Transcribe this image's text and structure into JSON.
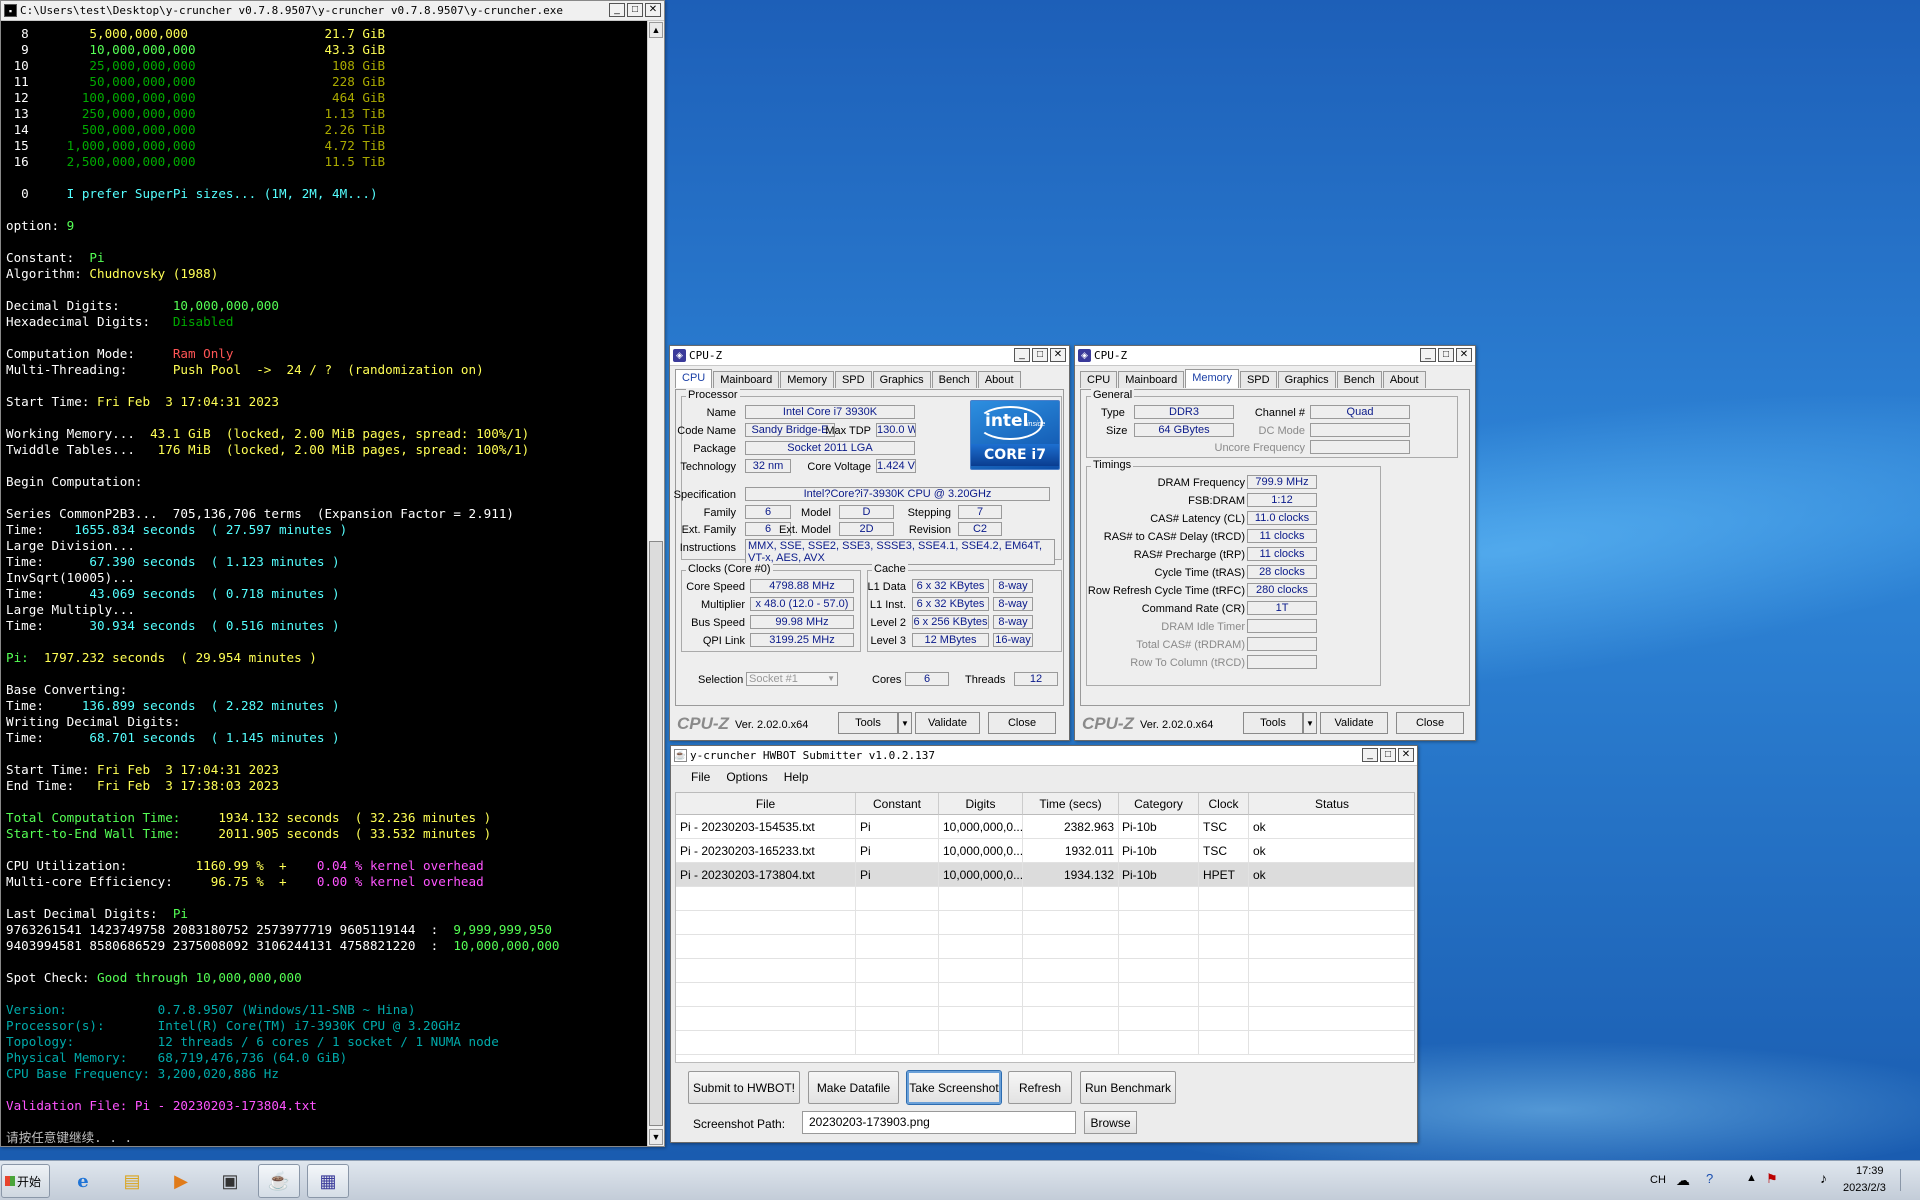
{
  "console": {
    "title": "C:\\Users\\test\\Desktop\\y-cruncher v0.7.8.9507\\y-cruncher v0.7.8.9507\\y-cruncher.exe",
    "lines": [
      [
        {
          "t": "  8        ",
          "c": "#ffffff"
        },
        {
          "t": "5,000,000,000",
          "c": "#ffff55"
        },
        {
          "t": "                  ",
          "c": "#ffffff"
        },
        {
          "t": "21.7 GiB",
          "c": "#ffff55"
        }
      ],
      [
        {
          "t": "  9        ",
          "c": "#ffffff"
        },
        {
          "t": "10,000,000,000",
          "c": "#55ff55"
        },
        {
          "t": "                 ",
          "c": "#ffffff"
        },
        {
          "t": "43.3 GiB",
          "c": "#ffff55"
        }
      ],
      [
        {
          "t": " 10        ",
          "c": "#ffffff"
        },
        {
          "t": "25,000,000,000",
          "c": "#00aa00"
        },
        {
          "t": "                  ",
          "c": "#ffffff"
        },
        {
          "t": "108 GiB",
          "c": "#aaaa00"
        }
      ],
      [
        {
          "t": " 11        ",
          "c": "#ffffff"
        },
        {
          "t": "50,000,000,000",
          "c": "#00aa00"
        },
        {
          "t": "                  ",
          "c": "#ffffff"
        },
        {
          "t": "228 GiB",
          "c": "#aaaa00"
        }
      ],
      [
        {
          "t": " 12       ",
          "c": "#ffffff"
        },
        {
          "t": "100,000,000,000",
          "c": "#00aa00"
        },
        {
          "t": "                  ",
          "c": "#ffffff"
        },
        {
          "t": "464 GiB",
          "c": "#aaaa00"
        }
      ],
      [
        {
          "t": " 13       ",
          "c": "#ffffff"
        },
        {
          "t": "250,000,000,000",
          "c": "#00aa00"
        },
        {
          "t": "                 ",
          "c": "#ffffff"
        },
        {
          "t": "1.13 TiB",
          "c": "#aaaa00"
        }
      ],
      [
        {
          "t": " 14       ",
          "c": "#ffffff"
        },
        {
          "t": "500,000,000,000",
          "c": "#00aa00"
        },
        {
          "t": "                 ",
          "c": "#ffffff"
        },
        {
          "t": "2.26 TiB",
          "c": "#aaaa00"
        }
      ],
      [
        {
          "t": " 15     ",
          "c": "#ffffff"
        },
        {
          "t": "1,000,000,000,000",
          "c": "#00aa00"
        },
        {
          "t": "                 ",
          "c": "#ffffff"
        },
        {
          "t": "4.72 TiB",
          "c": "#aaaa00"
        }
      ],
      [
        {
          "t": " 16     ",
          "c": "#ffffff"
        },
        {
          "t": "2,500,000,000,000",
          "c": "#00aa00"
        },
        {
          "t": "                 ",
          "c": "#ffffff"
        },
        {
          "t": "11.5 TiB",
          "c": "#aaaa00"
        }
      ],
      [],
      [
        {
          "t": "  0     ",
          "c": "#ffffff"
        },
        {
          "t": "I prefer SuperPi sizes... (1M, 2M, 4M...)",
          "c": "#55ffff"
        }
      ],
      [],
      [
        {
          "t": "option: ",
          "c": "#ffffff"
        },
        {
          "t": "9",
          "c": "#55ff55"
        }
      ],
      [],
      [
        {
          "t": "Constant:  ",
          "c": "#ffffff"
        },
        {
          "t": "Pi",
          "c": "#55ff55"
        }
      ],
      [
        {
          "t": "Algorithm: ",
          "c": "#ffffff"
        },
        {
          "t": "Chudnovsky (1988)",
          "c": "#ffff55"
        }
      ],
      [],
      [
        {
          "t": "Decimal Digits:       ",
          "c": "#ffffff"
        },
        {
          "t": "10,000,000,000",
          "c": "#55ff55"
        }
      ],
      [
        {
          "t": "Hexadecimal Digits:   ",
          "c": "#ffffff"
        },
        {
          "t": "Disabled",
          "c": "#00aa00"
        }
      ],
      [],
      [
        {
          "t": "Computation Mode:     ",
          "c": "#ffffff"
        },
        {
          "t": "Ram Only",
          "c": "#ff5555"
        }
      ],
      [
        {
          "t": "Multi-Threading:      ",
          "c": "#ffffff"
        },
        {
          "t": "Push Pool  ->  24 / ?  (randomization on)",
          "c": "#ffff55"
        }
      ],
      [],
      [
        {
          "t": "Start Time: ",
          "c": "#ffffff"
        },
        {
          "t": "Fri Feb  3 17:04:31 2023",
          "c": "#ffff55"
        }
      ],
      [],
      [
        {
          "t": "Working Memory...  ",
          "c": "#ffffff"
        },
        {
          "t": "43.1 GiB  (locked, 2.00 MiB pages, spread: 100%/1)",
          "c": "#ffff55"
        }
      ],
      [
        {
          "t": "Twiddle Tables...   ",
          "c": "#ffffff"
        },
        {
          "t": "176 MiB  (locked, 2.00 MiB pages, spread: 100%/1)",
          "c": "#ffff55"
        }
      ],
      [],
      [
        {
          "t": "Begin Computation:",
          "c": "#ffffff"
        }
      ],
      [],
      [
        {
          "t": "Series CommonP2B3...  705,136,706 terms  (Expansion Factor = 2.911)",
          "c": "#ffffff"
        }
      ],
      [
        {
          "t": "Time:    ",
          "c": "#ffffff"
        },
        {
          "t": "1655.834 seconds  ( 27.597 minutes )",
          "c": "#55ffff"
        }
      ],
      [
        {
          "t": "Large Division...",
          "c": "#ffffff"
        }
      ],
      [
        {
          "t": "Time:    ",
          "c": "#ffffff"
        },
        {
          "t": "  67.390 seconds  ( 1.123 minutes )",
          "c": "#55ffff"
        }
      ],
      [
        {
          "t": "InvSqrt(10005)...",
          "c": "#ffffff"
        }
      ],
      [
        {
          "t": "Time:    ",
          "c": "#ffffff"
        },
        {
          "t": "  43.069 seconds  ( 0.718 minutes )",
          "c": "#55ffff"
        }
      ],
      [
        {
          "t": "Large Multiply...",
          "c": "#ffffff"
        }
      ],
      [
        {
          "t": "Time:    ",
          "c": "#ffffff"
        },
        {
          "t": "  30.934 seconds  ( 0.516 minutes )",
          "c": "#55ffff"
        }
      ],
      [],
      [
        {
          "t": "Pi:  ",
          "c": "#55ff55"
        },
        {
          "t": "1797.232 seconds  ( 29.954 minutes )",
          "c": "#ffff55"
        }
      ],
      [],
      [
        {
          "t": "Base Converting:",
          "c": "#ffffff"
        }
      ],
      [
        {
          "t": "Time:    ",
          "c": "#ffffff"
        },
        {
          "t": " 136.899 seconds  ( 2.282 minutes )",
          "c": "#55ffff"
        }
      ],
      [
        {
          "t": "Writing Decimal Digits:",
          "c": "#ffffff"
        }
      ],
      [
        {
          "t": "Time:    ",
          "c": "#ffffff"
        },
        {
          "t": "  68.701 seconds  ( 1.145 minutes )",
          "c": "#55ffff"
        }
      ],
      [],
      [
        {
          "t": "Start Time: ",
          "c": "#ffffff"
        },
        {
          "t": "Fri Feb  3 17:04:31 2023",
          "c": "#ffff55"
        }
      ],
      [
        {
          "t": "End Time:   ",
          "c": "#ffffff"
        },
        {
          "t": "Fri Feb  3 17:38:03 2023",
          "c": "#ffff55"
        }
      ],
      [],
      [
        {
          "t": "Total Computation Time:     ",
          "c": "#55ff55"
        },
        {
          "t": "1934.132 seconds  ( 32.236 minutes )",
          "c": "#ffff55"
        }
      ],
      [
        {
          "t": "Start-to-End Wall Time:     ",
          "c": "#55ff55"
        },
        {
          "t": "2011.905 seconds  ( 33.532 minutes )",
          "c": "#ffff55"
        }
      ],
      [],
      [
        {
          "t": "CPU Utilization:         ",
          "c": "#ffffff"
        },
        {
          "t": "1160.99 %  +    ",
          "c": "#ffff55"
        },
        {
          "t": "0.04 % kernel overhead",
          "c": "#ff55ff"
        }
      ],
      [
        {
          "t": "Multi-core Efficiency:     ",
          "c": "#ffffff"
        },
        {
          "t": "96.75 %  +    ",
          "c": "#ffff55"
        },
        {
          "t": "0.00 % kernel overhead",
          "c": "#ff55ff"
        }
      ],
      [],
      [
        {
          "t": "Last Decimal Digits:  ",
          "c": "#ffffff"
        },
        {
          "t": "Pi",
          "c": "#55ff55"
        }
      ],
      [
        {
          "t": "9763261541 1423749758 2083180752 2573977719 9605119144  :  ",
          "c": "#ffffff"
        },
        {
          "t": "9,999,999,950",
          "c": "#55ff55"
        }
      ],
      [
        {
          "t": "9403994581 8580686529 2375008092 3106244131 4758821220  :  ",
          "c": "#ffffff"
        },
        {
          "t": "10,000,000,000",
          "c": "#55ff55"
        }
      ],
      [],
      [
        {
          "t": "Spot Check: ",
          "c": "#ffffff"
        },
        {
          "t": "Good through 10,000,000,000",
          "c": "#55ff55"
        }
      ],
      [],
      [
        {
          "t": "Version:            ",
          "c": "#00aaaa"
        },
        {
          "t": "0.7.8.9507 (Windows/11-SNB ~ Hina)",
          "c": "#00aaaa"
        }
      ],
      [
        {
          "t": "Processor(s):       ",
          "c": "#00aaaa"
        },
        {
          "t": "Intel(R) Core(TM) i7-3930K CPU @ 3.20GHz",
          "c": "#00aaaa"
        }
      ],
      [
        {
          "t": "Topology:           ",
          "c": "#00aaaa"
        },
        {
          "t": "12 threads / 6 cores / 1 socket / 1 NUMA node",
          "c": "#00aaaa"
        }
      ],
      [
        {
          "t": "Physical Memory:    ",
          "c": "#00aaaa"
        },
        {
          "t": "68,719,476,736 (64.0 GiB)",
          "c": "#00aaaa"
        }
      ],
      [
        {
          "t": "CPU Base Frequency: ",
          "c": "#00aaaa"
        },
        {
          "t": "3,200,020,886 Hz",
          "c": "#00aaaa"
        }
      ],
      [],
      [
        {
          "t": "Validation File: ",
          "c": "#ff55ff"
        },
        {
          "t": "Pi - 20230203-173804.txt",
          "c": "#ff55ff"
        }
      ],
      [],
      [
        {
          "t": "请按任意键继续. . .",
          "c": "#c0c0c0"
        }
      ]
    ]
  },
  "cpuz1": {
    "title": "CPU-Z",
    "tabs": [
      "CPU",
      "Mainboard",
      "Memory",
      "SPD",
      "Graphics",
      "Bench",
      "About"
    ],
    "processor_label": "Processor",
    "name_label": "Name",
    "name": "Intel Core i7 3930K",
    "codename_label": "Code Name",
    "codename": "Sandy Bridge-E",
    "maxtdp_label": "Max TDP",
    "maxtdp": "130.0 W",
    "package_label": "Package",
    "package": "Socket 2011 LGA",
    "tech_label": "Technology",
    "tech": "32 nm",
    "cv_label": "Core Voltage",
    "cv": "1.424 V",
    "spec_label": "Specification",
    "spec": "Intel?Core?i7-3930K CPU @ 3.20GHz",
    "family_label": "Family",
    "family": "6",
    "model_label": "Model",
    "model": "D",
    "stepping_label": "Stepping",
    "stepping": "7",
    "extfam_label": "Ext. Family",
    "extfam": "6",
    "extmod_label": "Ext. Model",
    "extmod": "2D",
    "rev_label": "Revision",
    "rev": "C2",
    "instr_label": "Instructions",
    "instr": "MMX, SSE, SSE2, SSE3, SSSE3, SSE4.1, SSE4.2, EM64T, VT-x, AES, AVX",
    "clocks_label": "Clocks (Core #0)",
    "cs_label": "Core Speed",
    "cs": "4798.88 MHz",
    "mult_label": "Multiplier",
    "mult": "x 48.0 (12.0 - 57.0)",
    "bus_label": "Bus Speed",
    "bus": "99.98 MHz",
    "qpi_label": "QPI Link",
    "qpi": "3199.25 MHz",
    "cache_label": "Cache",
    "l1d_label": "L1 Data",
    "l1d": "6 x 32 KBytes",
    "l1d_w": "8-way",
    "l1i_label": "L1 Inst.",
    "l1i": "6 x 32 KBytes",
    "l1i_w": "8-way",
    "l2_label": "Level 2",
    "l2": "6 x 256 KBytes",
    "l2_w": "8-way",
    "l3_label": "Level 3",
    "l3": "12 MBytes",
    "l3_w": "16-way",
    "sel_label": "Selection",
    "sel": "Socket #1",
    "cores_label": "Cores",
    "cores": "6",
    "threads_label": "Threads",
    "threads": "12",
    "logo_text": "intel",
    "logo_inside": "inside",
    "logo_core": "CORE i7",
    "brand": "CPU-Z",
    "version": "Ver. 2.02.0.x64",
    "tools": "Tools",
    "validate": "Validate",
    "close": "Close"
  },
  "cpuz2": {
    "title": "CPU-Z",
    "tabs": [
      "CPU",
      "Mainboard",
      "Memory",
      "SPD",
      "Graphics",
      "Bench",
      "About"
    ],
    "general_label": "General",
    "type_label": "Type",
    "type": "DDR3",
    "channel_label": "Channel #",
    "channel": "Quad",
    "size_label": "Size",
    "size": "64 GBytes",
    "dcmode_label": "DC Mode",
    "uncore_label": "Uncore Frequency",
    "timings_label": "Timings",
    "dram_label": "DRAM Frequency",
    "dram": "799.9 MHz",
    "fsb_label": "FSB:DRAM",
    "fsb": "1:12",
    "cl_label": "CAS# Latency (CL)",
    "cl": "11.0 clocks",
    "trcd_label": "RAS# to CAS# Delay (tRCD)",
    "trcd": "11 clocks",
    "trp_label": "RAS# Precharge (tRP)",
    "trp": "11 clocks",
    "tras_label": "Cycle Time (tRAS)",
    "tras": "28 clocks",
    "trfc_label": "Row Refresh Cycle Time (tRFC)",
    "trfc": "280 clocks",
    "cr_label": "Command Rate (CR)",
    "cr": "1T",
    "idle_label": "DRAM Idle Timer",
    "trdram_label": "Total CAS# (tRDRAM)",
    "rtc_label": "Row To Column (tRCD)",
    "brand": "CPU-Z",
    "version": "Ver. 2.02.0.x64",
    "tools": "Tools",
    "validate": "Validate",
    "close": "Close"
  },
  "hwbot": {
    "title": "y-cruncher HWBOT Submitter v1.0.2.137",
    "menu": [
      "File",
      "Options",
      "Help"
    ],
    "headers": [
      "File",
      "Constant",
      "Digits",
      "Time (secs)",
      "Category",
      "Clock",
      "Status"
    ],
    "rows": [
      [
        "Pi - 20230203-154535.txt",
        "Pi",
        "10,000,000,0...",
        "2382.963",
        "Pi-10b",
        "TSC",
        "ok"
      ],
      [
        "Pi - 20230203-165233.txt",
        "Pi",
        "10,000,000,0...",
        "1932.011",
        "Pi-10b",
        "TSC",
        "ok"
      ],
      [
        "Pi - 20230203-173804.txt",
        "Pi",
        "10,000,000,0...",
        "1934.132",
        "Pi-10b",
        "HPET",
        "ok"
      ]
    ],
    "buttons": [
      "Submit to HWBOT!",
      "Make Datafile",
      "Take Screenshot",
      "Refresh",
      "Run Benchmark"
    ],
    "path_label": "Screenshot Path:",
    "path_value": "20230203-173903.png",
    "browse": "Browse"
  },
  "taskbar": {
    "start": "开始",
    "lang": "CH",
    "time": "17:39",
    "date": "2023/2/3"
  }
}
